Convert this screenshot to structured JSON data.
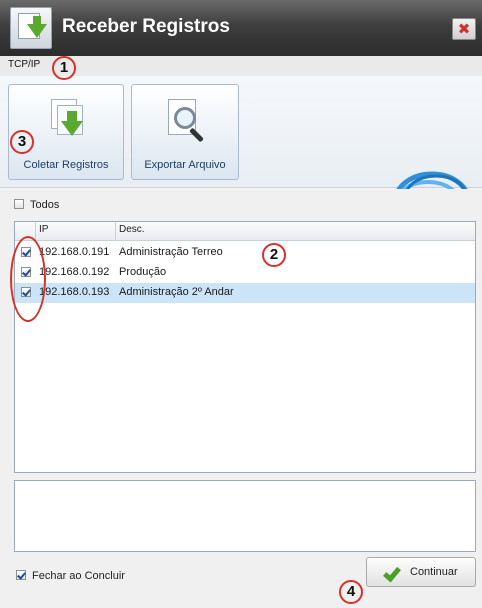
{
  "window": {
    "title": "Receber Registros",
    "close_symbol": "✖"
  },
  "tabs": [
    {
      "label": "TCP/IP"
    }
  ],
  "ribbon": {
    "buttons": [
      {
        "label": "Coletar Registros",
        "icon": "collect-records-icon"
      },
      {
        "label": "Exportar Arquivo",
        "icon": "magnifier-document-icon"
      }
    ],
    "decoration": "network-cable-icon"
  },
  "list": {
    "select_all_label": "Todos",
    "select_all_checked": false,
    "columns": {
      "ip": "IP",
      "desc": "Desc."
    },
    "rows": [
      {
        "checked": true,
        "ip": "192.168.0.191",
        "desc": "Administração Terreo",
        "selected": false
      },
      {
        "checked": true,
        "ip": "192.168.0.192",
        "desc": "Produção",
        "selected": false
      },
      {
        "checked": true,
        "ip": "192.168.0.193",
        "desc": "Administração 2º Andar",
        "selected": true
      }
    ]
  },
  "log_text": "",
  "footer": {
    "close_on_finish_label": "Fechar ao Concluir",
    "close_on_finish_checked": true,
    "continue_label": "Continuar"
  },
  "annotations": [
    "1",
    "2",
    "3",
    "4"
  ],
  "colors": {
    "annotation": "#d8302a",
    "accent_green": "#49a02a",
    "selection": "#cce4f7"
  }
}
